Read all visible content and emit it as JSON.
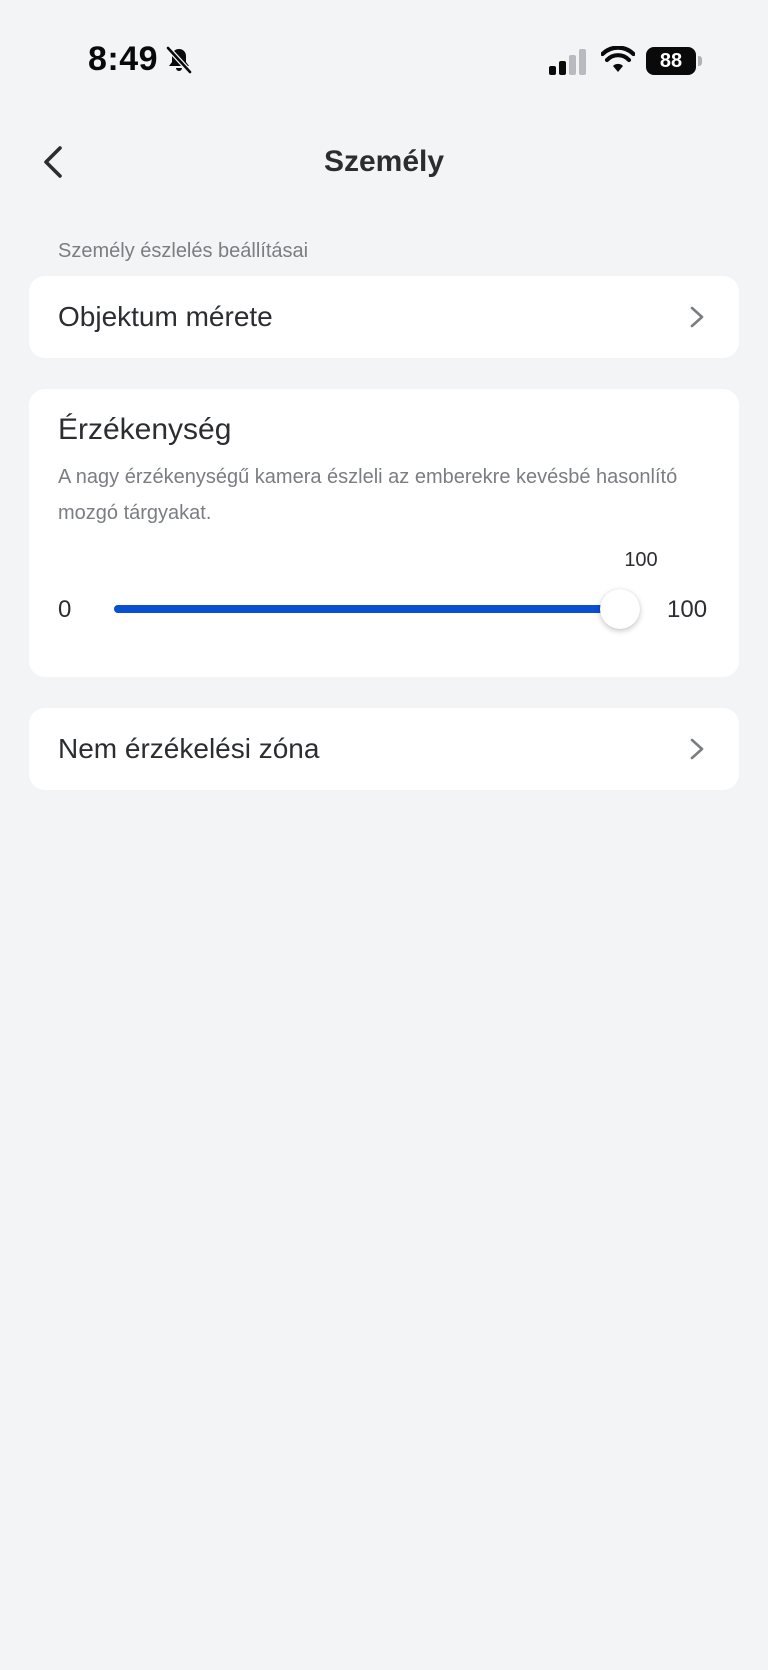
{
  "status_bar": {
    "time": "8:49",
    "battery_level": "88",
    "icons": [
      "bell-slash-icon",
      "cellular-signal-icon",
      "wifi-icon",
      "battery-icon"
    ]
  },
  "header": {
    "title": "Személy",
    "back_icon": "chevron-left-icon"
  },
  "section": {
    "caption": "Személy észlelés beállításai"
  },
  "object_size": {
    "label": "Objektum mérete",
    "icon": "chevron-right-icon"
  },
  "sensitivity": {
    "title": "Érzékenység",
    "description": "A nagy érzékenységű kamera észleli az emberekre kevésbé hasonlító mozgó tárgyakat.",
    "current_value": "100",
    "min_label": "0",
    "max_label": "100",
    "value": 100,
    "min": 0,
    "max": 100
  },
  "no_detection_zone": {
    "label": "Nem érzékelési zóna",
    "icon": "chevron-right-icon"
  },
  "colors": {
    "accent": "#0a4fd1",
    "background": "#f3f4f6",
    "card": "#ffffff",
    "secondary_text": "#7a7d82"
  }
}
